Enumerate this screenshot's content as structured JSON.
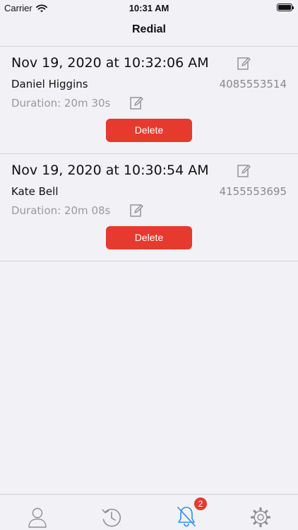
{
  "status_bar": {
    "carrier": "Carrier",
    "time": "10:31 AM"
  },
  "nav": {
    "title": "Redial"
  },
  "records": [
    {
      "date": "Nov 19, 2020 at 10:32:06 AM",
      "name": "Daniel Higgins",
      "phone": "4085553514",
      "duration": "Duration: 20m 30s",
      "delete_label": "Delete"
    },
    {
      "date": "Nov 19, 2020 at 10:30:54 AM",
      "name": "Kate Bell",
      "phone": "4155553695",
      "duration": "Duration: 20m 08s",
      "delete_label": "Delete"
    }
  ],
  "tab_bar": {
    "tabs": [
      {
        "icon": "person-icon",
        "active": false
      },
      {
        "icon": "history-clock-icon",
        "active": false
      },
      {
        "icon": "bell-slash-icon",
        "active": true
      },
      {
        "icon": "gear-icon",
        "active": false
      }
    ],
    "notification_badge": "2"
  },
  "colors": {
    "accent": "#2f8cf5",
    "delete": "#e63a2f",
    "background": "#f2f2f6",
    "icon_gray": "#8e8e93"
  }
}
